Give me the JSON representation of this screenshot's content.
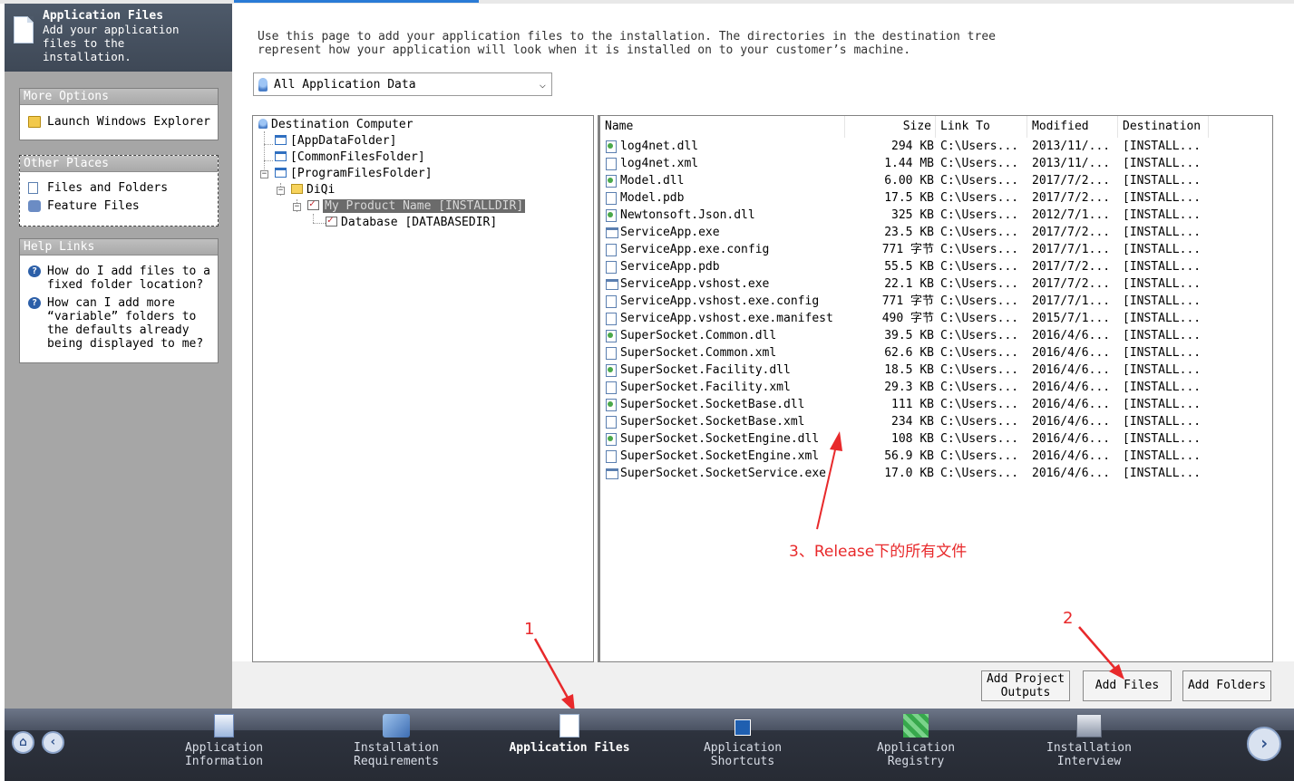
{
  "header": {
    "title": "Application Files",
    "description": "Add your application files to the installation."
  },
  "sidebar": {
    "more_options": {
      "title": "More Options",
      "items": [
        {
          "label": "Launch Windows Explorer",
          "icon": "folder-explore-icon"
        }
      ]
    },
    "other_places": {
      "title": "Other Places",
      "items": [
        {
          "label": "Files and Folders",
          "icon": "file-icon"
        },
        {
          "label": "Feature Files",
          "icon": "feature-icon"
        }
      ]
    },
    "help_links": {
      "title": "Help Links",
      "items": [
        {
          "label": "How do I add files to a fixed folder location?",
          "icon": "help-icon"
        },
        {
          "label": "How can I add more “variable” folders to the defaults already being displayed to me?",
          "icon": "help-icon"
        }
      ]
    }
  },
  "main": {
    "intro": "Use this page to add your application files to the installation. The directories in the destination tree represent how your application will look when it is installed on to your customer’s machine.",
    "filter": {
      "selected": "All Application Data"
    },
    "tree": {
      "root": "Destination Computer",
      "nodes": [
        {
          "label": "[AppDataFolder]"
        },
        {
          "label": "[CommonFilesFolder]"
        },
        {
          "label": "[ProgramFilesFolder]"
        },
        {
          "label": "DiQi"
        },
        {
          "label": "My Product Name [INSTALLDIR]",
          "selected": true
        },
        {
          "label": "Database [DATABASEDIR]"
        }
      ]
    },
    "columns": {
      "name": "Name",
      "size": "Size",
      "link_to": "Link To",
      "modified": "Modified",
      "destination": "Destination"
    },
    "files": [
      {
        "name": "log4net.dll",
        "size": "294 KB",
        "link_to": "C:\\Users...",
        "modified": "2013/11/...",
        "destination": "[INSTALL...",
        "type": "dll"
      },
      {
        "name": "log4net.xml",
        "size": "1.44 MB",
        "link_to": "C:\\Users...",
        "modified": "2013/11/...",
        "destination": "[INSTALL...",
        "type": "doc"
      },
      {
        "name": "Model.dll",
        "size": "6.00 KB",
        "link_to": "C:\\Users...",
        "modified": "2017/7/2...",
        "destination": "[INSTALL...",
        "type": "dll"
      },
      {
        "name": "Model.pdb",
        "size": "17.5 KB",
        "link_to": "C:\\Users...",
        "modified": "2017/7/2...",
        "destination": "[INSTALL...",
        "type": "doc"
      },
      {
        "name": "Newtonsoft.Json.dll",
        "size": "325 KB",
        "link_to": "C:\\Users...",
        "modified": "2012/7/1...",
        "destination": "[INSTALL...",
        "type": "dll"
      },
      {
        "name": "ServiceApp.exe",
        "size": "23.5 KB",
        "link_to": "C:\\Users...",
        "modified": "2017/7/2...",
        "destination": "[INSTALL...",
        "type": "exe"
      },
      {
        "name": "ServiceApp.exe.config",
        "size": "771 字节",
        "link_to": "C:\\Users...",
        "modified": "2017/7/1...",
        "destination": "[INSTALL...",
        "type": "doc"
      },
      {
        "name": "ServiceApp.pdb",
        "size": "55.5 KB",
        "link_to": "C:\\Users...",
        "modified": "2017/7/2...",
        "destination": "[INSTALL...",
        "type": "doc"
      },
      {
        "name": "ServiceApp.vshost.exe",
        "size": "22.1 KB",
        "link_to": "C:\\Users...",
        "modified": "2017/7/2...",
        "destination": "[INSTALL...",
        "type": "exe"
      },
      {
        "name": "ServiceApp.vshost.exe.config",
        "size": "771 字节",
        "link_to": "C:\\Users...",
        "modified": "2017/7/1...",
        "destination": "[INSTALL...",
        "type": "doc"
      },
      {
        "name": "ServiceApp.vshost.exe.manifest",
        "size": "490 字节",
        "link_to": "C:\\Users...",
        "modified": "2015/7/1...",
        "destination": "[INSTALL...",
        "type": "doc"
      },
      {
        "name": "SuperSocket.Common.dll",
        "size": "39.5 KB",
        "link_to": "C:\\Users...",
        "modified": "2016/4/6...",
        "destination": "[INSTALL...",
        "type": "dll"
      },
      {
        "name": "SuperSocket.Common.xml",
        "size": "62.6 KB",
        "link_to": "C:\\Users...",
        "modified": "2016/4/6...",
        "destination": "[INSTALL...",
        "type": "doc"
      },
      {
        "name": "SuperSocket.Facility.dll",
        "size": "18.5 KB",
        "link_to": "C:\\Users...",
        "modified": "2016/4/6...",
        "destination": "[INSTALL...",
        "type": "dll"
      },
      {
        "name": "SuperSocket.Facility.xml",
        "size": "29.3 KB",
        "link_to": "C:\\Users...",
        "modified": "2016/4/6...",
        "destination": "[INSTALL...",
        "type": "doc"
      },
      {
        "name": "SuperSocket.SocketBase.dll",
        "size": "111 KB",
        "link_to": "C:\\Users...",
        "modified": "2016/4/6...",
        "destination": "[INSTALL...",
        "type": "dll"
      },
      {
        "name": "SuperSocket.SocketBase.xml",
        "size": "234 KB",
        "link_to": "C:\\Users...",
        "modified": "2016/4/6...",
        "destination": "[INSTALL...",
        "type": "doc"
      },
      {
        "name": "SuperSocket.SocketEngine.dll",
        "size": "108 KB",
        "link_to": "C:\\Users...",
        "modified": "2016/4/6...",
        "destination": "[INSTALL...",
        "type": "dll"
      },
      {
        "name": "SuperSocket.SocketEngine.xml",
        "size": "56.9 KB",
        "link_to": "C:\\Users...",
        "modified": "2016/4/6...",
        "destination": "[INSTALL...",
        "type": "doc"
      },
      {
        "name": "SuperSocket.SocketService.exe",
        "size": "17.0 KB",
        "link_to": "C:\\Users...",
        "modified": "2016/4/6...",
        "destination": "[INSTALL...",
        "type": "exe"
      }
    ],
    "buttons": {
      "add_project_outputs": "Add Project Outputs",
      "add_files": "Add Files",
      "add_folders": "Add Folders"
    }
  },
  "annotations": {
    "note_3": "3、Release下的所有文件",
    "marker_1": "1",
    "marker_2": "2",
    "color": "#e8292b"
  },
  "bottom_nav": {
    "steps": [
      {
        "label": "Application Information",
        "icon": "info-icon"
      },
      {
        "label": "Installation Requirements",
        "icon": "requirements-icon"
      },
      {
        "label": "Application Files",
        "icon": "files-icon",
        "active": true
      },
      {
        "label": "Application Shortcuts",
        "icon": "shortcut-icon"
      },
      {
        "label": "Application Registry",
        "icon": "registry-icon"
      },
      {
        "label": "Installation Interview",
        "icon": "interview-icon"
      }
    ]
  },
  "colors": {
    "accent": "#2a7bd6",
    "sidebar_bg": "#a6a6a6",
    "nav_bg": "#2d323d"
  }
}
